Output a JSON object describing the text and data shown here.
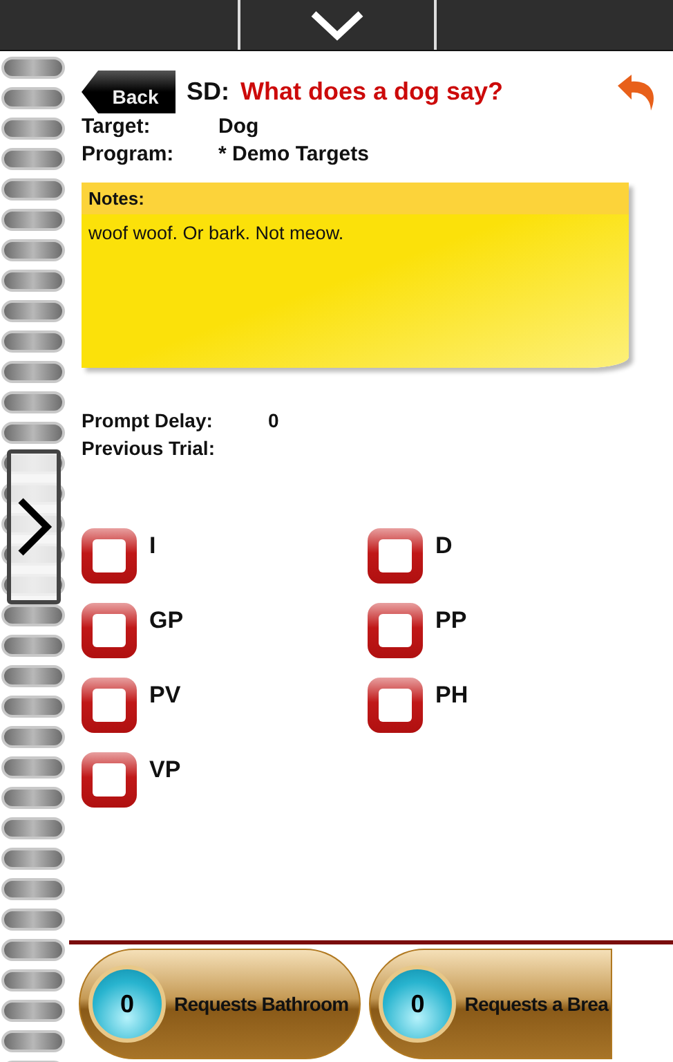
{
  "header": {
    "back": "Back",
    "sd_label": "SD:",
    "sd_text": "What does a dog say?"
  },
  "info": [
    {
      "label": "Target:",
      "value": "Dog"
    },
    {
      "label": "Program:",
      "value": "* Demo Targets"
    }
  ],
  "notes": {
    "title": "Notes:",
    "text": "woof woof. Or bark. Not meow."
  },
  "details": [
    {
      "label": "Prompt Delay:",
      "value": "0"
    },
    {
      "label": "Previous Trial:"
    }
  ],
  "prompts": [
    {
      "label": "I",
      "checked": false
    },
    {
      "label": "D",
      "checked": false
    },
    {
      "label": "GP",
      "checked": false
    },
    {
      "label": "PP",
      "checked": false
    },
    {
      "label": "PV",
      "checked": false
    },
    {
      "label": "PH",
      "checked": false
    },
    {
      "label": "VP",
      "checked": false
    }
  ],
  "counters": [
    {
      "count": "0",
      "label": "Requests Bathroom"
    },
    {
      "count": "0",
      "label": "Requests a Brea"
    }
  ]
}
